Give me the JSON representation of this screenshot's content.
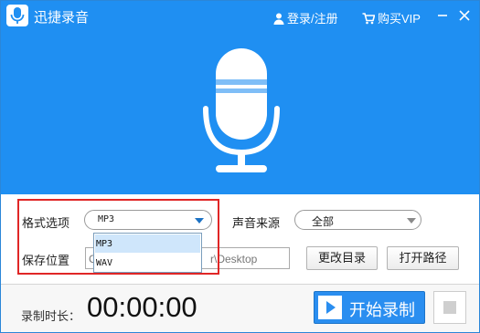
{
  "window": {
    "title": "迅捷录音",
    "login_label": "登录/注册",
    "vip_label": "购买VIP",
    "accent_color": "#1f8ff2",
    "highlight_color": "#e02626"
  },
  "icons": {
    "app": "microphone-logo-icon",
    "login": "user-icon",
    "vip": "cart-icon",
    "minimize": "minimize-icon",
    "close": "close-icon",
    "hero": "microphone-icon",
    "start": "play-icon",
    "stop": "stop-icon"
  },
  "settings": {
    "format_label": "格式选项",
    "format_value": "MP3",
    "format_options": [
      "MP3",
      "WAV"
    ],
    "source_label": "声音来源",
    "source_value": "全部",
    "save_label": "保存位置",
    "save_path_visible": "C",
    "save_path_tail": "r\\Desktop",
    "change_dir_button": "更改目录",
    "open_path_button": "打开路径"
  },
  "recording": {
    "duration_label": "录制时长：",
    "duration": "00:00:00",
    "start_button": "开始录制"
  }
}
